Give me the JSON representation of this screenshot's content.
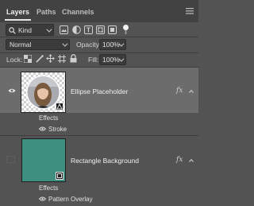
{
  "tabs": [
    {
      "label": "Layers",
      "active": true
    },
    {
      "label": "Paths",
      "active": false
    },
    {
      "label": "Channels",
      "active": false
    }
  ],
  "filter": {
    "kind_label": "Kind"
  },
  "blend": {
    "mode": "Normal",
    "opacity_label": "Opacity:",
    "opacity_value": "100%"
  },
  "lock": {
    "label": "Lock:",
    "fill_label": "Fill:",
    "fill_value": "100%"
  },
  "layers": [
    {
      "name": "Ellipse Placeholder",
      "visible": true,
      "selected": true,
      "effects_label": "Effects",
      "effects": [
        "Stroke"
      ],
      "fx_label": "fx"
    },
    {
      "name": "Rectangle Background",
      "visible": false,
      "selected": false,
      "thumb_color": "#3f8f80",
      "effects_label": "Effects",
      "effects": [
        "Pattern Overlay"
      ],
      "fx_label": "fx"
    }
  ],
  "colors": {
    "panel": "#535353",
    "selected_row": "#6c6c6c",
    "tabbar": "#424242"
  }
}
